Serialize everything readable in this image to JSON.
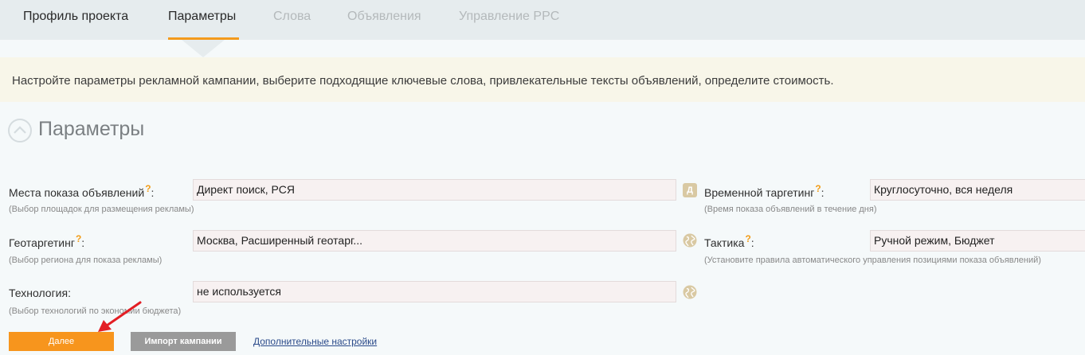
{
  "tabs": [
    {
      "label": "Профиль проекта",
      "state": "done"
    },
    {
      "label": "Параметры",
      "state": "active"
    },
    {
      "label": "Слова",
      "state": "disabled"
    },
    {
      "label": "Объявления",
      "state": "disabled"
    },
    {
      "label": "Управление PPC",
      "state": "disabled"
    }
  ],
  "notice": {
    "text": "Настройте параметры рекламной кампании, выберите подходящие ключевые слова, привлекательные тексты объявлений, определите стоимость."
  },
  "section": {
    "title": "Параметры",
    "icon": "chevron-up-circle-icon"
  },
  "fields": {
    "placement": {
      "label": "Места показа объявлений",
      "help": "?",
      "colon": ":",
      "hint": "(Выбор площадок для размещения рекламы)",
      "value": "Директ поиск, РСЯ",
      "icon": "direct-icon",
      "icon_text": "Д"
    },
    "geo": {
      "label": "Геотаргетинг",
      "help": "?",
      "colon": ":",
      "hint": "(Выбор региона для показа рекламы)",
      "value": "Москва, Расширенный геотарг...",
      "icon": "globe-icon"
    },
    "tech": {
      "label": "Технология:",
      "hint": "(Выбор технологий по экономии бюджета)",
      "value": "не используется",
      "icon": "globe-icon"
    },
    "time": {
      "label": "Временной таргетинг",
      "help": "?",
      "colon": ":",
      "hint": "(Время показа объявлений в течение дня)",
      "value": "Круглосуточно, вся неделя"
    },
    "tactic": {
      "label": "Тактика",
      "help": "?",
      "colon": ":",
      "hint": "(Установите правила автоматического управления позициями показа объявлений)",
      "value": "Ручной режим, Бюджет"
    }
  },
  "actions": {
    "next_label": "Далее",
    "import_label": "Импорт кампании",
    "more_label": "Дополнительные настройки"
  },
  "colors": {
    "accent": "#f7951d",
    "tab_underline": "#f39a1c",
    "annotation_arrow": "#e31e24"
  }
}
